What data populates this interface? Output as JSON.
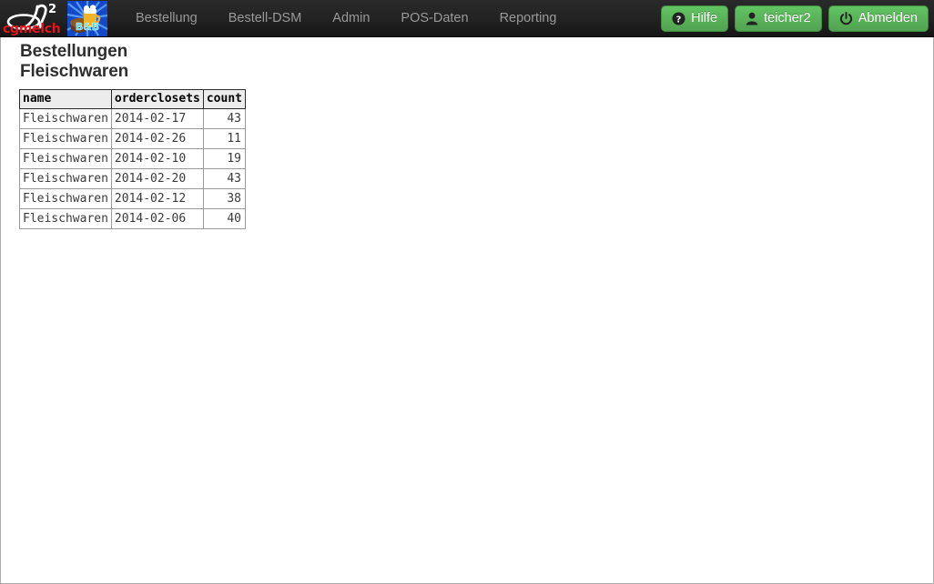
{
  "navbar": {
    "brand": {
      "logo_text": "cgmelch",
      "logo_symbol": "eh2",
      "app_icon_name": "beer-bb-icon",
      "app_icon_label": "B&B"
    },
    "items": [
      {
        "label": "Bestellung"
      },
      {
        "label": "Bestell-DSM"
      },
      {
        "label": "Admin"
      },
      {
        "label": "POS-Daten"
      },
      {
        "label": "Reporting"
      }
    ],
    "actions": [
      {
        "label": "Hilfe",
        "icon": "question-circle-icon"
      },
      {
        "label": "teicher2",
        "icon": "user-icon"
      },
      {
        "label": "Abmelden",
        "icon": "power-icon"
      }
    ],
    "colors": {
      "background": "#222222",
      "nav_text": "#999999",
      "button_green": "#51a351",
      "logo_red": "#e8121a"
    }
  },
  "main": {
    "title_line1": "Bestellungen",
    "title_line2": "Fleischwaren",
    "table": {
      "columns": [
        "name",
        "orderclosets",
        "count"
      ],
      "rows": [
        {
          "name": "Fleischwaren",
          "orderclosets": "2014-02-17",
          "count": "43"
        },
        {
          "name": "Fleischwaren",
          "orderclosets": "2014-02-26",
          "count": "11"
        },
        {
          "name": "Fleischwaren",
          "orderclosets": "2014-02-10",
          "count": "19"
        },
        {
          "name": "Fleischwaren",
          "orderclosets": "2014-02-20",
          "count": "43"
        },
        {
          "name": "Fleischwaren",
          "orderclosets": "2014-02-12",
          "count": "38"
        },
        {
          "name": "Fleischwaren",
          "orderclosets": "2014-02-06",
          "count": "40"
        }
      ]
    }
  }
}
